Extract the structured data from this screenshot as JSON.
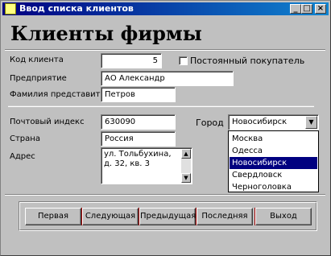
{
  "window": {
    "title": "Ввод списка клиентов",
    "minimize_glyph": "_",
    "maximize_glyph": "□",
    "close_glyph": "×"
  },
  "heading": "Клиенты фирмы",
  "fields": {
    "client_code": {
      "label": "Код клиента",
      "value": "5"
    },
    "regular_customer": {
      "label": "Постоянный покупатель",
      "checked": false
    },
    "company": {
      "label": "Предприятие",
      "value": "АО Александр"
    },
    "contact_surname": {
      "label": "Фамилия представителя",
      "value": "Петров"
    },
    "postal_code": {
      "label": "Почтовый индекс",
      "value": "630090"
    },
    "country": {
      "label": "Страна",
      "value": "Россия"
    },
    "address": {
      "label": "Адрес",
      "value": "ул. Тольбухина, д. 32, кв. 3"
    },
    "city": {
      "label": "Город",
      "value": "Новосибирск",
      "options": [
        "Москва",
        "Одесса",
        "Новосибирск",
        "Свердловск",
        "Черноголовка"
      ],
      "selected_index": 2
    }
  },
  "nav_buttons": {
    "first": "Первая",
    "next": "Следующая",
    "prev": "Предыдущая",
    "last": "Последняя",
    "exit": "Выход"
  },
  "colors": {
    "titlebar_start": "#000080",
    "titlebar_end": "#1084d0",
    "selection": "#000080",
    "face": "#c0c0c0"
  }
}
